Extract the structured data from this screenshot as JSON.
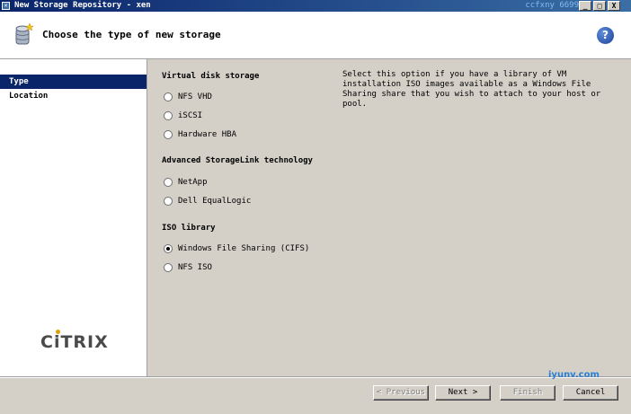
{
  "window": {
    "title": "New Storage Repository - xen",
    "minimize_glyph": "_",
    "maximize_glyph": "□",
    "close_glyph": "X"
  },
  "header": {
    "title": "Choose the type of new storage",
    "icon": "storage-repository-icon",
    "help_glyph": "?"
  },
  "sidebar": {
    "items": [
      {
        "label": "Type",
        "active": true
      },
      {
        "label": "Location",
        "active": false
      }
    ],
    "brand": "CiTRIX"
  },
  "main": {
    "groups": [
      {
        "heading": "Virtual disk storage",
        "options": [
          {
            "label": "NFS VHD",
            "selected": false
          },
          {
            "label": "iSCSI",
            "selected": false
          },
          {
            "label": "Hardware HBA",
            "selected": false
          }
        ]
      },
      {
        "heading": "Advanced StorageLink technology",
        "options": [
          {
            "label": "NetApp",
            "selected": false
          },
          {
            "label": "Dell EqualLogic",
            "selected": false
          }
        ]
      },
      {
        "heading": "ISO library",
        "options": [
          {
            "label": "Windows File Sharing (CIFS)",
            "selected": true
          },
          {
            "label": "NFS ISO",
            "selected": false
          }
        ]
      }
    ],
    "description": "Select this option if you have a library of VM installation ISO images available as a Windows File Sharing share that you wish to attach to your host or pool."
  },
  "footer": {
    "previous_label": "< Previous",
    "next_label": "Next >",
    "finish_label": "Finish",
    "cancel_label": "Cancel"
  },
  "watermarks": {
    "top": "ccfxny 6699",
    "bottom": "iyunv.com"
  }
}
